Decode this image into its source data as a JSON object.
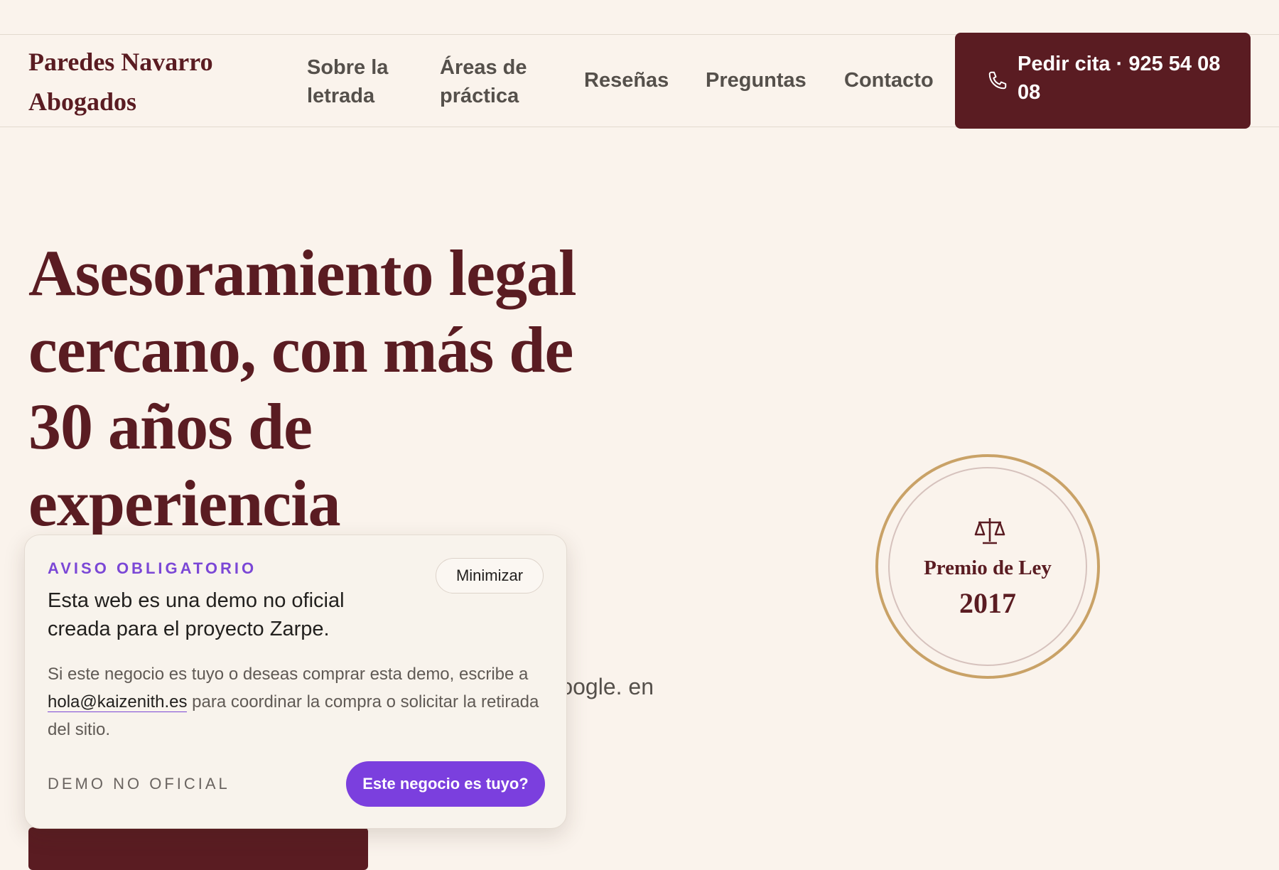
{
  "header": {
    "brand": "Paredes Navarro Abogados",
    "nav": [
      {
        "label": "Sobre la letrada"
      },
      {
        "label": "Áreas de práctica"
      },
      {
        "label": "Reseñas"
      },
      {
        "label": "Preguntas"
      },
      {
        "label": "Contacto"
      }
    ],
    "cta_label": "Pedir cita · 925 54 08 08"
  },
  "hero": {
    "title": "Asesoramiento legal cercano, con más de 30 años de experiencia",
    "text_visible": "Google. en"
  },
  "badge": {
    "icon": "scales-icon",
    "label": "Premio de Ley",
    "year": "2017"
  },
  "notice": {
    "eyebrow": "AVISO OBLIGATORIO",
    "title": "Esta web es una demo no oficial creada para el proyecto Zarpe.",
    "minimize_label": "Minimizar",
    "body_before": "Si este negocio es tuyo o deseas comprar esta demo, escribe a ",
    "email": "hola@kaizenith.es",
    "body_after": " para coordinar la compra o solicitar la retirada del sitio.",
    "footer_label": "DEMO NO OFICIAL",
    "owner_button": "Este negocio es tuyo?"
  },
  "colors": {
    "brand": "#5a1c22",
    "accent": "#7b3fde",
    "gold": "#c9a267",
    "background": "#faf3ec"
  }
}
